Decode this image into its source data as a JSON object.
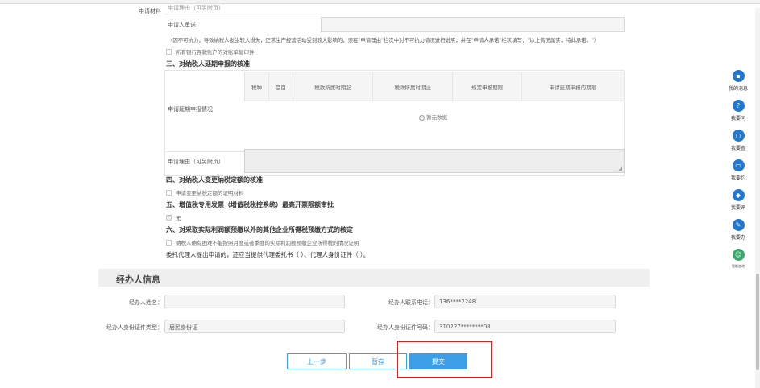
{
  "section2": {
    "left_label": "申请材料",
    "reason_label": "申请理由（可另附页）",
    "promise_label": "申请人承诺",
    "note": "（因不可抗力，导致纳税人发生较大损失，正常生产经营活动受到较大影响的，须在\"申请理由\"栏次中对不可抗力情况进行说明，并在\"申请人承诺\"栏次填写：\"以上情况属实，特此承诺。\"）",
    "bank_statement": "所有银行存款账户的对账单复印件"
  },
  "section3": {
    "title": "三、对纳税人延期申报的核准",
    "apply_label": "申请延期申报情况",
    "columns": [
      "税种",
      "品目",
      "税款所属时期起",
      "税款所属时期止",
      "规定申报期限",
      "申请延期申报的期限"
    ],
    "empty_text": "暂无数据",
    "reason_label": "申请理由（可另附页）"
  },
  "section4": {
    "title": "四、对纳税人变更纳税定额的核准",
    "item": "申请变更纳税定额的证明材料"
  },
  "section5": {
    "title": "五、增值税专用发票（增值税税控系统）最高开票限额审批",
    "item": "无"
  },
  "section6": {
    "title": "六、对采取实际利润额预缴以外的其他企业所得税预缴方式的核定",
    "item": "纳税人确有困难不能按照月度或者季度的实际利润额预缴企业所得税的情况证明",
    "agent_note": "委托代理人提出申请的，还应当提供代理委托书（ ）、代理人身份证件（ ）。"
  },
  "agent": {
    "header": "经办人信息",
    "name_label": "经办人姓名：",
    "name_value": "",
    "phone_label": "经办人联系电话：",
    "phone_value": "136****2248",
    "idtype_label": "经办人身份证件类型：",
    "idtype_value": "居民身份证",
    "idno_label": "经办人身份证件号码：",
    "idno_value": "310227********08"
  },
  "buttons": {
    "prev": "上一步",
    "save": "暂存",
    "submit": "提交"
  },
  "sidebar": [
    {
      "label": "我的消息",
      "icon": "message-icon"
    },
    {
      "label": "我要问",
      "icon": "question-icon"
    },
    {
      "label": "我要查",
      "icon": "search-icon"
    },
    {
      "label": "我要约",
      "icon": "calendar-icon"
    },
    {
      "label": "我要评",
      "icon": "rating-icon"
    },
    {
      "label": "我要办",
      "icon": "edit-icon"
    },
    {
      "label": "智能咨询",
      "icon": "robot-icon"
    }
  ],
  "colors": {
    "primary": "#3c9ee5",
    "sidebar_icon": "#1f78d1",
    "highlight": "#d9221c"
  }
}
